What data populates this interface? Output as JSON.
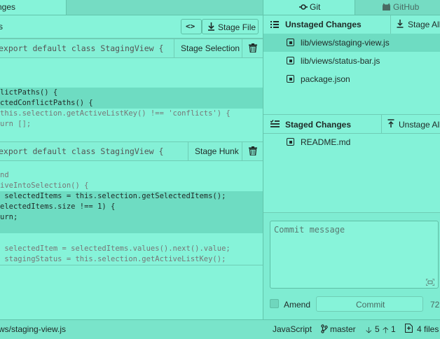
{
  "left": {
    "tab_label": "nges",
    "header_title": "s",
    "nav_icon": "<>",
    "stage_file_label": "Stage File",
    "hunks": [
      {
        "title": "export default class StagingView {",
        "action_label": "Stage Selection",
        "lines": [
          {
            "text": "",
            "sel": false,
            "dark": false
          },
          {
            "text": "",
            "sel": false,
            "dark": false
          },
          {
            "text": "",
            "sel": false,
            "dark": false
          },
          {
            "text": "lictPaths() {",
            "sel": true,
            "dark": true
          },
          {
            "text": "ctedConflictPaths() {",
            "sel": true,
            "dark": true
          },
          {
            "text": "this.selection.getActiveListKey() !== 'conflicts') {",
            "sel": false,
            "dark": false
          },
          {
            "text": "urn [];",
            "sel": false,
            "dark": false
          }
        ]
      },
      {
        "title": "export default class StagingView {",
        "action_label": "Stage Hunk",
        "lines": [
          {
            "text": "",
            "sel": false,
            "dark": false
          },
          {
            "text": "nd",
            "sel": false,
            "dark": false
          },
          {
            "text": "iveIntoSelection() {",
            "sel": false,
            "dark": false
          },
          {
            "text": " selectedItems = this.selection.getSelectedItems();",
            "sel": true,
            "dark": true
          },
          {
            "text": "electedItems.size !== 1) {",
            "sel": true,
            "dark": true
          },
          {
            "text": "urn;",
            "sel": true,
            "dark": true
          },
          {
            "text": "",
            "sel": true,
            "dark": true
          },
          {
            "text": "",
            "sel": false,
            "dark": false
          },
          {
            "text": " selectedItem = selectedItems.values().next().value;",
            "sel": false,
            "dark": false
          },
          {
            "text": " stagingStatus = this.selection.getActiveListKey();",
            "sel": false,
            "dark": false
          }
        ]
      }
    ]
  },
  "right": {
    "tabs": {
      "git": "Git",
      "github": "GitHub"
    },
    "unstaged_title": "Unstaged Changes",
    "stage_all_label": "Stage All",
    "unstaged_files": [
      "lib/views/staging-view.js",
      "lib/views/status-bar.js",
      "package.json"
    ],
    "staged_title": "Staged Changes",
    "unstage_all_label": "Unstage All",
    "staged_files": [
      "README.md"
    ],
    "commit_placeholder": "Commit message",
    "amend_label": "Amend",
    "commit_label": "Commit",
    "char_count": "72"
  },
  "statusbar": {
    "path": "ws/staging-view.js",
    "language": "JavaScript",
    "branch": "master",
    "behind": "5",
    "ahead": "1",
    "files": "4 files"
  },
  "colors": {
    "accent": "#84f2d8",
    "selection": "#6edcc2"
  }
}
